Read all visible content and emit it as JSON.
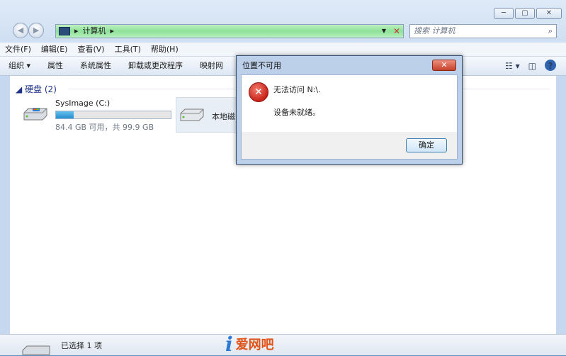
{
  "address": {
    "crumbs": [
      "计算机"
    ]
  },
  "search": {
    "placeholder": "搜索 计算机"
  },
  "menu": [
    "文件(F)",
    "编辑(E)",
    "查看(V)",
    "工具(T)",
    "帮助(H)"
  ],
  "commands": [
    "组织 ▾",
    "属性",
    "系统属性",
    "卸载或更改程序",
    "映射网"
  ],
  "group": {
    "label": "硬盘 (2)"
  },
  "drives": [
    {
      "name": "SysImage (C:)",
      "info": "84.4 GB 可用，共 99.9 GB",
      "used_fraction": 0.155
    },
    {
      "name": "本地磁"
    }
  ],
  "dialog": {
    "title": "位置不可用",
    "line1": "无法访问 N:\\.",
    "line2": "设备未就绪。",
    "ok": "确定"
  },
  "status": {
    "text": "已选择 1 项"
  },
  "watermark": {
    "text": "爱网吧"
  }
}
